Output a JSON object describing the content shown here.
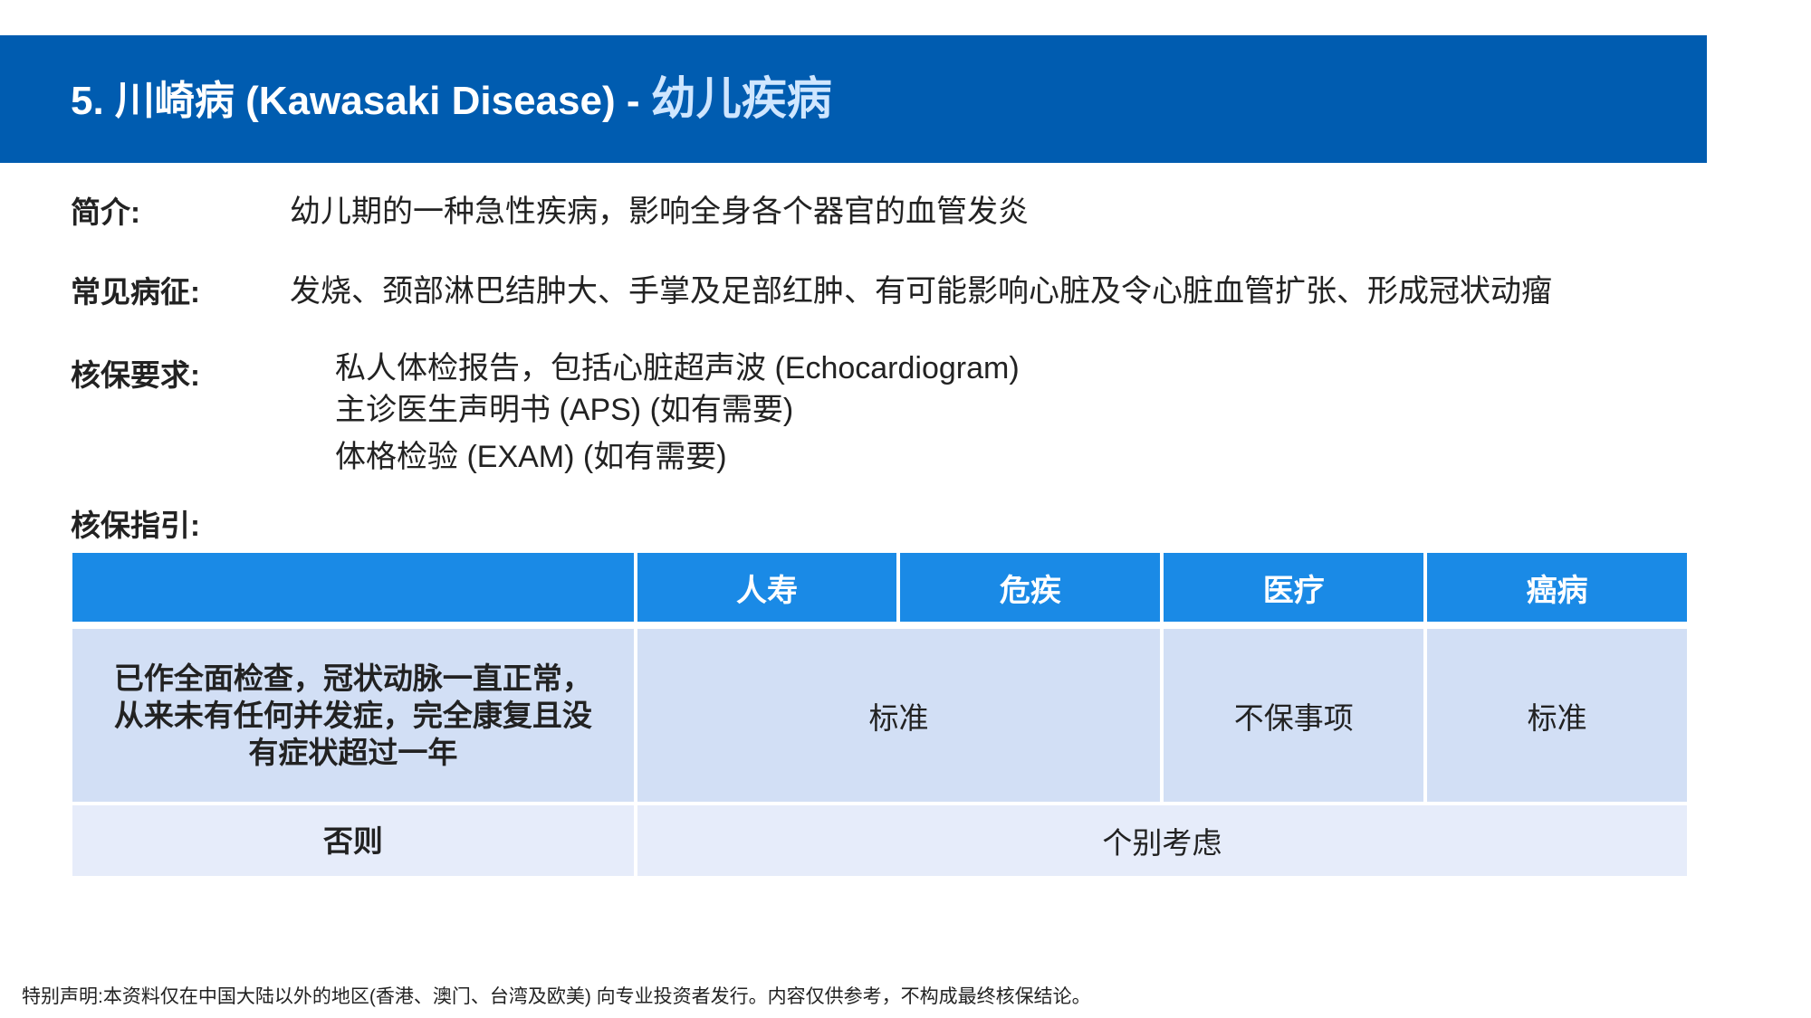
{
  "header": {
    "title_main": "5. 川崎病 (Kawasaki Disease) - ",
    "title_sub": "幼儿疾病"
  },
  "intro": {
    "label": "简介:",
    "text": "幼儿期的一种急性疾病，影响全身各个器官的血管发炎"
  },
  "symptoms": {
    "label": "常见病征:",
    "text": "发烧、颈部淋巴结肿大、手掌及足部红肿、有可能影响心脏及令心脏血管扩张、形成冠状动瘤"
  },
  "requirements": {
    "label": "核保要求:",
    "items": [
      "私人体检报告，包括心脏超声波 (Echocardiogram)",
      "主诊医生声明书 (APS) (如有需要)",
      "体格检验 (EXAM) (如有需要)"
    ]
  },
  "guide": {
    "label": "核保指引:",
    "headers": [
      "",
      "人寿",
      "危疾",
      "医疗",
      "癌病"
    ],
    "rows": [
      {
        "condition_lines": [
          "已作全面检查，冠状动脉一直正常，",
          "从来未有任何并发症，完全康复且没",
          "有症状超过一年"
        ],
        "life_critical": "标准",
        "medical": "不保事项",
        "cancer": "标准"
      },
      {
        "condition": "否则",
        "all": "个别考虑"
      }
    ]
  },
  "footer": "特别声明:本资料仅在中国大陆以外的地区(香港、澳门、台湾及欧美) 向专业投资者发行。内容仅供参考，不构成最终核保结论。",
  "colors": {
    "header_bg": "#005cb0",
    "table_header_bg": "#1a8ae6",
    "row1_bg": "#d2dff5",
    "row2_bg": "#e6ecfa"
  }
}
